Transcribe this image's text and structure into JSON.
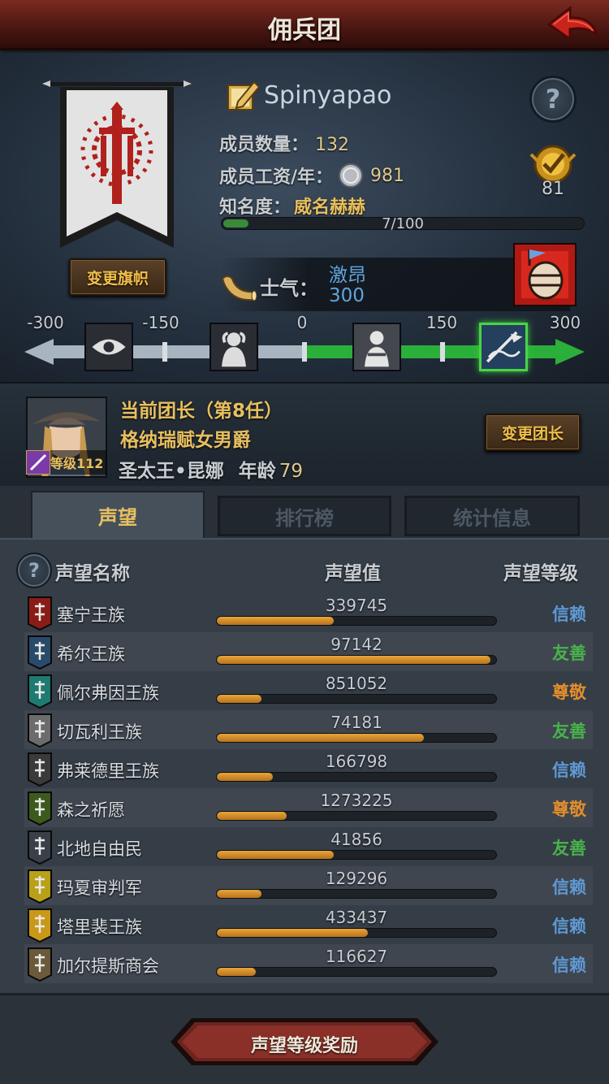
{
  "title": "佣兵团",
  "header": {
    "player_name": "Spinyapao",
    "members_label": "成员数量：",
    "members_value": "132",
    "wage_label": "成员工资/年：",
    "wage_value": "981",
    "fame_label": "知名度：",
    "fame_value": "威名赫赫",
    "fame_progress_text": "7/100",
    "fame_progress": 0.07,
    "badge_value": "81",
    "change_banner_label": "变更旗帜",
    "morale_label": "士气：",
    "morale_state": "激昂",
    "morale_value": "300",
    "track_ticks": [
      "-300",
      "-150",
      "0",
      "150",
      "300"
    ]
  },
  "leader": {
    "title": "当前团长（第8任）",
    "rank": "格纳瑞赋女男爵",
    "name": "圣太王•昆娜",
    "age_label": "年龄",
    "age_value": "79",
    "level_label": "等级112",
    "change_leader_label": "变更团长"
  },
  "tabs": [
    {
      "label": "声望",
      "active": true
    },
    {
      "label": "排行榜",
      "active": false
    },
    {
      "label": "统计信息",
      "active": false
    }
  ],
  "table": {
    "headers": {
      "name": "声望名称",
      "value": "声望值",
      "level": "声望等级"
    },
    "rows": [
      {
        "name": "塞宁王族",
        "value": "339745",
        "progress": 0.42,
        "level": "信赖",
        "level_type": "trust",
        "icon_color": "#8a1c18"
      },
      {
        "name": "希尔王族",
        "value": "97142",
        "progress": 0.98,
        "level": "友善",
        "level_type": "friendly",
        "icon_color": "#2a4a6a"
      },
      {
        "name": "佩尔弗因王族",
        "value": "851052",
        "progress": 0.16,
        "level": "尊敬",
        "level_type": "respect",
        "icon_color": "#1f7a72"
      },
      {
        "name": "切瓦利王族",
        "value": "74181",
        "progress": 0.74,
        "level": "友善",
        "level_type": "friendly",
        "icon_color": "#6c6c6c"
      },
      {
        "name": "弗莱德里王族",
        "value": "166798",
        "progress": 0.2,
        "level": "信赖",
        "level_type": "trust",
        "icon_color": "#3a3a3a"
      },
      {
        "name": "森之祈愿",
        "value": "1273225",
        "progress": 0.25,
        "level": "尊敬",
        "level_type": "respect",
        "icon_color": "#3b5a1c"
      },
      {
        "name": "北地自由民",
        "value": "41856",
        "progress": 0.42,
        "level": "友善",
        "level_type": "friendly",
        "icon_color": "#3a4048"
      },
      {
        "name": "玛夏审判军",
        "value": "129296",
        "progress": 0.16,
        "level": "信赖",
        "level_type": "trust",
        "icon_color": "#b8a018"
      },
      {
        "name": "塔里裴王族",
        "value": "433437",
        "progress": 0.54,
        "level": "信赖",
        "level_type": "trust",
        "icon_color": "#c89818"
      },
      {
        "name": "加尔提斯商会",
        "value": "116627",
        "progress": 0.14,
        "level": "信赖",
        "level_type": "trust",
        "icon_color": "#6a5a3a"
      }
    ]
  },
  "reward_button_label": "声望等级奖励"
}
